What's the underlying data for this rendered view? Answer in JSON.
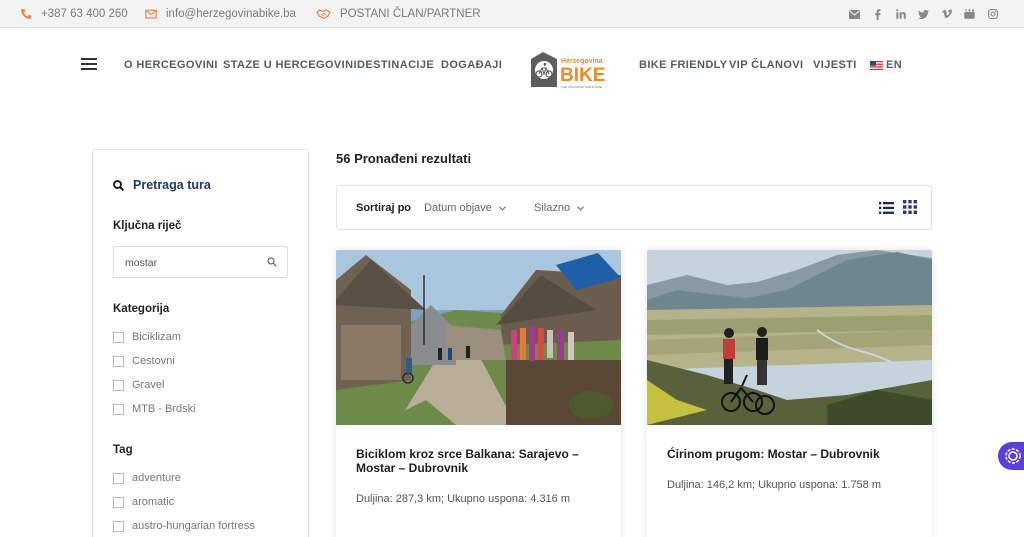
{
  "topbar": {
    "phone": "+387 63 400 260",
    "email": "info@herzegovinabike.ba",
    "partner": "POSTANI ČLAN/PARTNER",
    "accent": "#e8894a",
    "socials": [
      "envelope-icon",
      "facebook-icon",
      "linkedin-icon",
      "twitter-icon",
      "vimeo-icon",
      "youtube-icon",
      "instagram-icon"
    ]
  },
  "nav": {
    "left": [
      "O HERCEGOVINI",
      "STAZE U HERCEGOVINI",
      "DESTINACIJE",
      "DOGAĐAJI"
    ],
    "right": [
      "BIKE FRIENDLY",
      "VIP ČLANOVI",
      "VIJESTI",
      "EN"
    ],
    "logo_text_top": "Herzegovina",
    "logo_text_main": "BIKE",
    "logo_tagline": "THE UNFORGETTABLE RIDE"
  },
  "sidebar": {
    "title": "Pretraga tura",
    "keyword_label": "Ključna riječ",
    "keyword_value": "mostar",
    "category_label": "Kategorija",
    "categories": [
      "Biciklizam",
      "Cestovni",
      "Gravel",
      "MTB - Brdski"
    ],
    "tag_label": "Tag",
    "tags": [
      "adventure",
      "aromatic",
      "austro-hungarian fortress"
    ]
  },
  "main": {
    "results": "56 Pronađeni rezultati",
    "sort_label": "Sortiraj po",
    "sort_by": "Datum objave",
    "sort_order": "Silazno"
  },
  "cards": [
    {
      "title": "Biciklom kroz srce Balkana: Sarajevo – Mostar – Dubrovnik",
      "meta": "Duljina: 287,3 km; Ukupno uspona: 4.316 m"
    },
    {
      "title": "Ćirinom prugom: Mostar – Dubrovnik",
      "meta": "Duljina: 146,2 km; Ukupno uspona: 1.758 m"
    }
  ],
  "colors": {
    "brand_orange": "#f08a24",
    "nav_text": "#555b66",
    "title_blue": "#1d3a6b",
    "accessibility": "#5b3fd6"
  }
}
